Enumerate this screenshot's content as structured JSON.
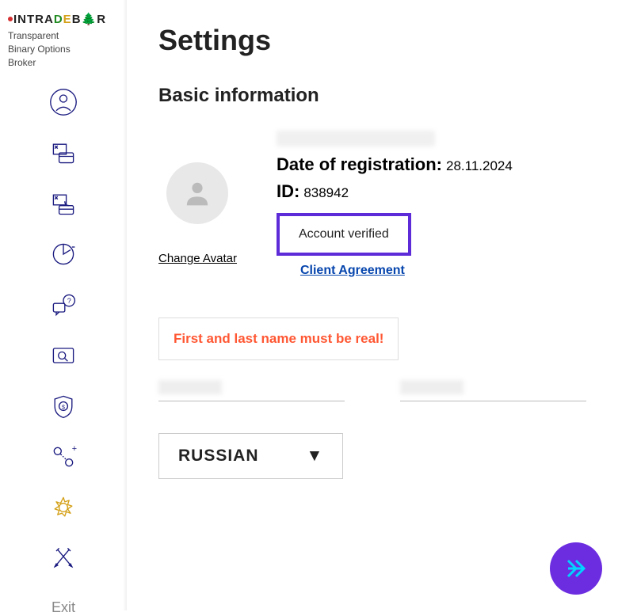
{
  "brand": {
    "logo_parts": [
      "INTRA",
      "D",
      "E",
      " B",
      "A",
      "R"
    ],
    "tagline_line1": "Transparent",
    "tagline_line2": "Binary Options",
    "tagline_line3": "Broker"
  },
  "sidebar": {
    "exit_label": "Exit"
  },
  "settings": {
    "title": "Settings",
    "section_title": "Basic information",
    "change_avatar": "Change Avatar",
    "registration_label": "Date of registration:",
    "registration_value": "28.11.2024",
    "id_label": "ID:",
    "id_value": "838942",
    "verified_text": "Account verified",
    "client_agreement": "Client Agreement",
    "name_warning": "First and last name must be real!",
    "language_selected": "RUSSIAN"
  }
}
